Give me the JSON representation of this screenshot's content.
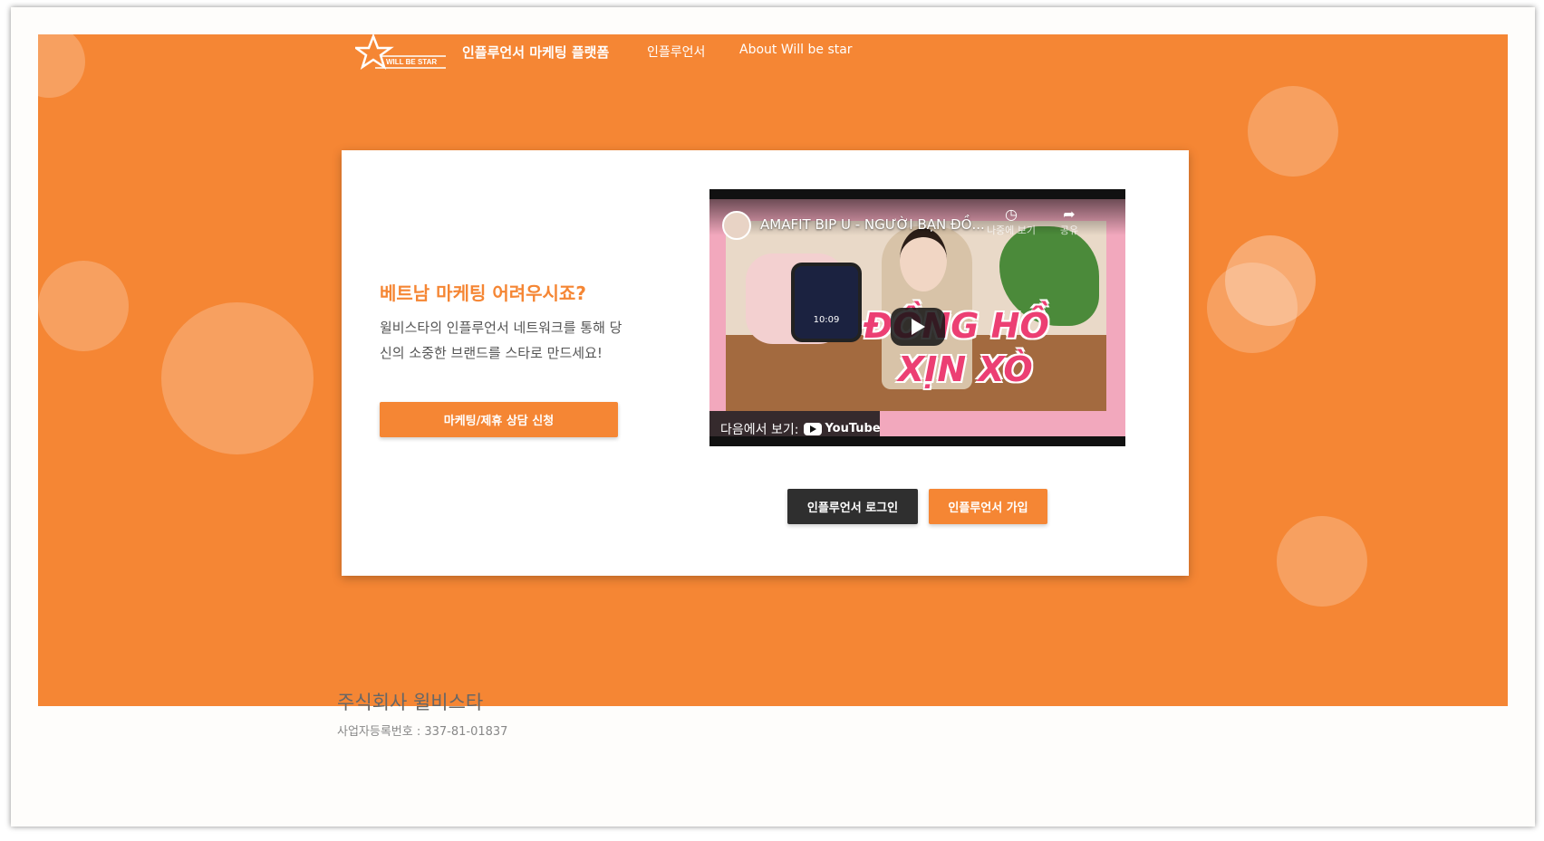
{
  "nav": {
    "logo_text": "WILL BE STAR",
    "brand_link": "인플루언서 마케팅 플랫폼",
    "influencer_link": "인플루언서",
    "about_link": "About Will be star"
  },
  "hero": {
    "title": "베트남 마케팅 어려우시죠?",
    "description": "윌비스타의 인플루언서 네트워크를 통해 당신의 소중한 브랜드를 스타로 만드세요!",
    "consult_button": "마케팅/제휴 상담 신청",
    "login_button": "인플루언서 로그인",
    "join_button": "인플루언서 가입"
  },
  "video": {
    "title": "AMAFIT BIP U - NGƯỜI BẠN ĐỒ...",
    "watch_later": "나중에 보기",
    "share": "공유",
    "watch_on": "다음에서 보기:",
    "youtube": "YouTube",
    "thumb_time": "10:09",
    "overlay_line1": "ĐỒNG HỒ",
    "overlay_line2": "XỊN XÒ"
  },
  "footer": {
    "company": "주식회사 윌비스타",
    "registration": "사업자등록번호 : 337-81-01837"
  },
  "colors": {
    "accent": "#f58634",
    "dark_button": "#2f2f2f"
  }
}
